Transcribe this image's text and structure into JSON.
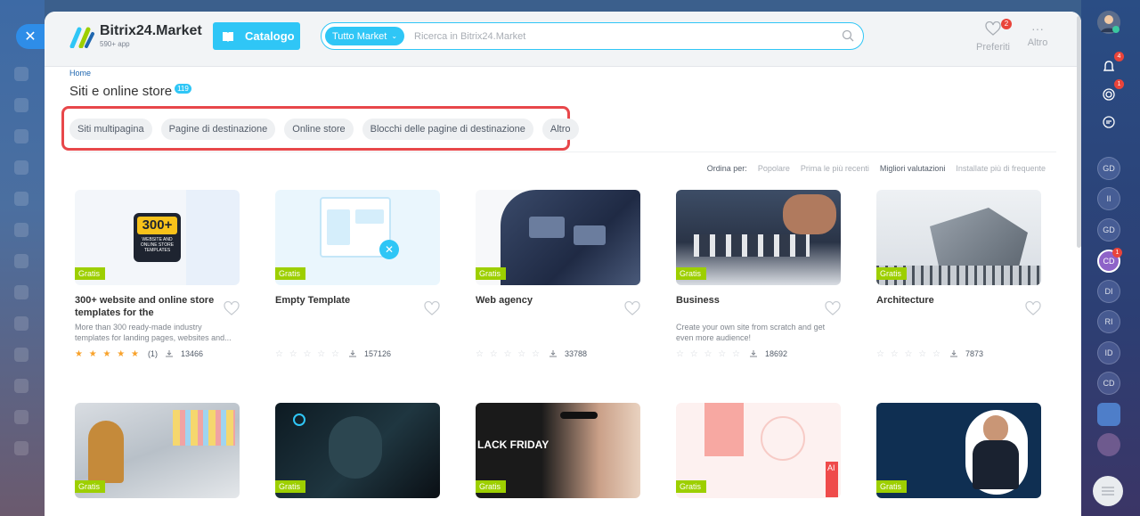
{
  "header": {
    "logo_name": "Bitrix24.Market",
    "logo_sub": "590+ app",
    "catalog_label": "Catalogo",
    "search_category": "Tutto Market",
    "search_placeholder": "Ricerca in Bitrix24.Market",
    "favorites_label": "Preferiti",
    "favorites_count": "2",
    "more_label": "Altro"
  },
  "breadcrumb": "Home",
  "page_title": "Siti e online store",
  "page_count": "119",
  "filters": [
    "Siti multipagina",
    "Pagine di destinazione",
    "Online store",
    "Blocchi delle pagine di destinazione",
    "Altro"
  ],
  "sort": {
    "label": "Ordina per:",
    "options": [
      "Popolare",
      "Prima le più recenti",
      "Migliori valutazioni",
      "Installate più di frequente"
    ]
  },
  "badge_label": "Gratis",
  "cards": [
    {
      "title": "300+ website and online store templates for the Bitrix24.Sites...",
      "desc": "More than 300 ready-made industry templates for landing pages, websites and...",
      "stars": "★ ★ ★ ★ ★",
      "reviews": "(1)",
      "installs": "13466",
      "thumb_text": "300+",
      "thumb_sub": "WEBSITE AND ONLINE STORE TEMPLATES"
    },
    {
      "title": "Empty Template",
      "desc": "",
      "stars": "☆ ☆ ☆ ☆ ☆",
      "reviews": "",
      "installs": "157126"
    },
    {
      "title": "Web agency",
      "desc": "",
      "stars": "☆ ☆ ☆ ☆ ☆",
      "reviews": "",
      "installs": "33788"
    },
    {
      "title": "Business",
      "desc": "Create your own site from scratch and get even more audience!",
      "stars": "☆ ☆ ☆ ☆ ☆",
      "reviews": "",
      "installs": "18692"
    },
    {
      "title": "Architecture",
      "desc": "",
      "stars": "☆ ☆ ☆ ☆ ☆",
      "reviews": "",
      "installs": "7873"
    }
  ],
  "row2_texts": [
    "LACK FRIDAY",
    "AI"
  ],
  "right_bar": {
    "notifications_badge": "4",
    "rings_badge": "1",
    "cd_badge": "1",
    "items": [
      "GD",
      "II",
      "GD",
      "CD",
      "DI",
      "RI",
      "ID",
      "CD"
    ]
  },
  "colors": {
    "accent": "#2fc6f6",
    "gratis": "#9dcf00",
    "highlight": "#e8474a"
  }
}
